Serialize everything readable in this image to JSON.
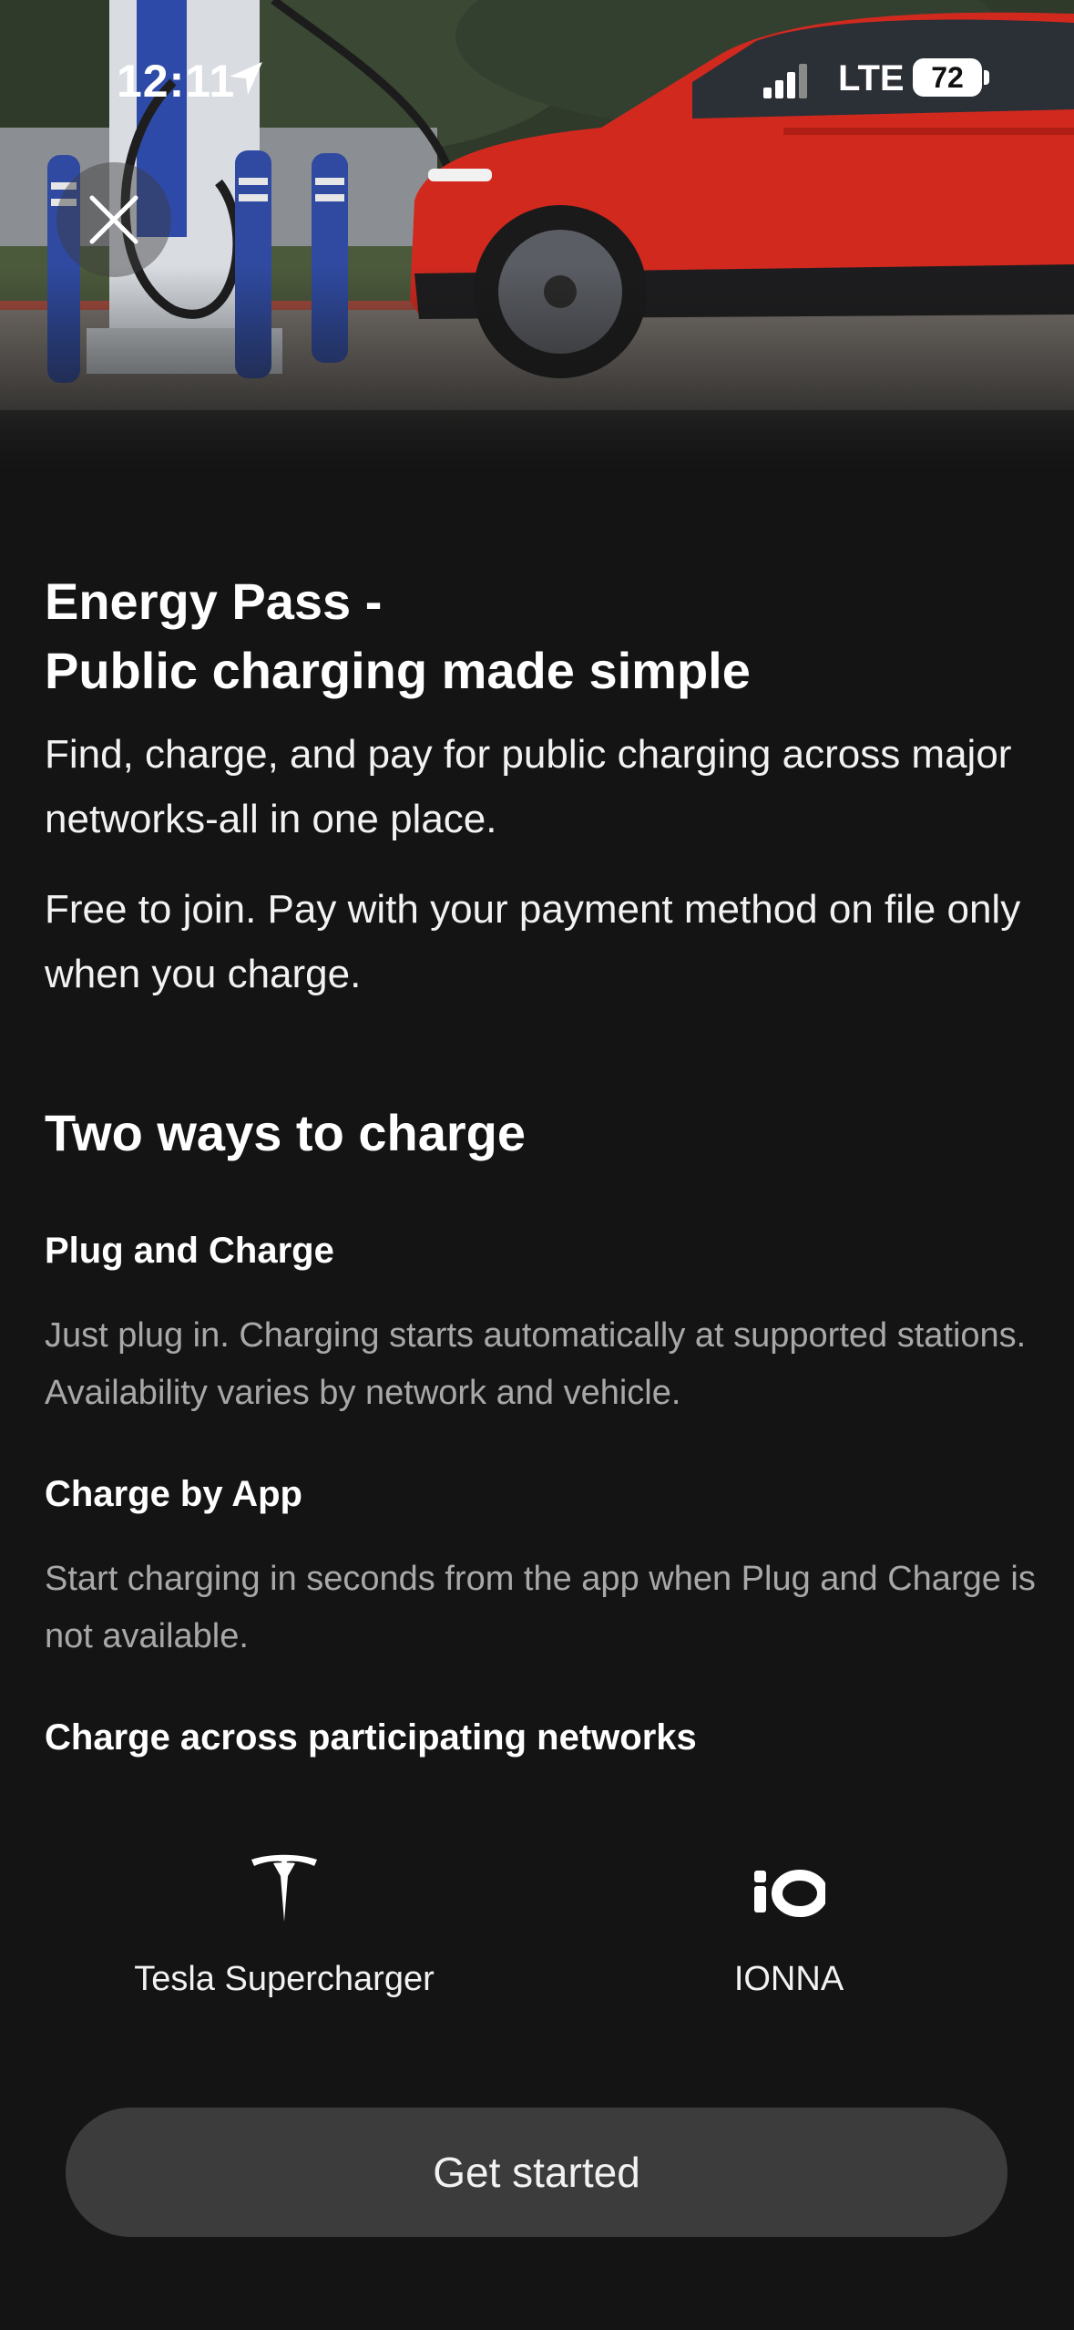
{
  "status_bar": {
    "time": "12:11",
    "network": "LTE",
    "battery": "72"
  },
  "hero": {
    "image_icon": "car-charging-photo",
    "close_icon": "close-icon"
  },
  "content": {
    "title_line1": "Energy Pass -",
    "title_line2": "Public charging made simple",
    "intro": "Find, charge, and pay for public charging across major networks-all in one place.",
    "free_note": "Free to join. Pay with your payment method on file only when you charge.",
    "section_title": "Two ways to charge",
    "plug_title": "Plug and Charge",
    "plug_desc": "Just plug in. Charging starts automatically at supported stations. Availability varies by network and vehicle.",
    "app_title": "Charge by App",
    "app_desc": "Start charging in seconds from the app when Plug and Charge is not available.",
    "networks_title": "Charge across participating networks"
  },
  "networks": [
    {
      "name": "Tesla Supercharger",
      "icon": "tesla-logo-icon"
    },
    {
      "name": "IONNA",
      "icon": "ionna-logo-icon"
    }
  ],
  "cta": {
    "label": "Get started"
  }
}
